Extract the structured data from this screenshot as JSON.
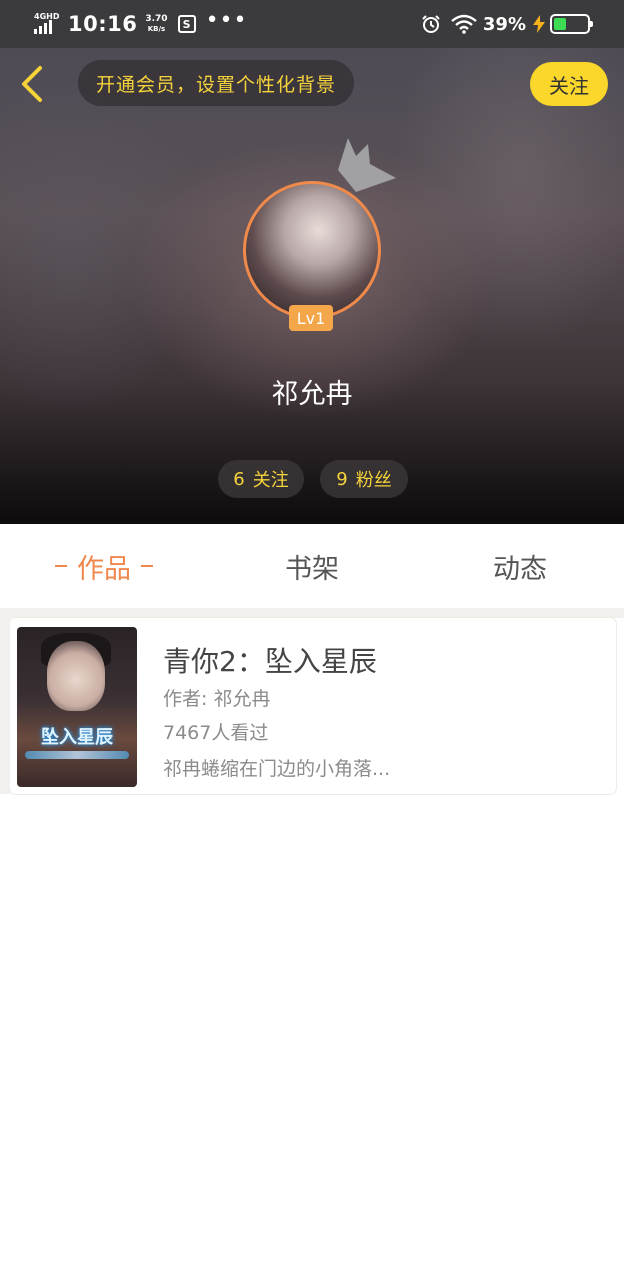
{
  "status_bar": {
    "network": "4GHD",
    "time": "10:16",
    "speed_value": "3.70",
    "speed_unit": "KB/s",
    "app_glyph": "S",
    "more": "•••",
    "battery_percent": "39%",
    "battery_level": 0.39,
    "icons": [
      "alarm-icon",
      "wifi-icon",
      "charging-icon",
      "battery-icon"
    ]
  },
  "header": {
    "vip_banner": "开通会员，设置个性化背景",
    "follow_label": "关注",
    "back_icon": "chevron-left-icon"
  },
  "profile": {
    "level": "Lv1",
    "username": "祁允冉",
    "following_count": "6",
    "following_label": "关注",
    "fans_count": "9",
    "fans_label": "粉丝"
  },
  "tabs": [
    {
      "label": "作品",
      "active": true
    },
    {
      "label": "书架",
      "active": false
    },
    {
      "label": "动态",
      "active": false
    }
  ],
  "works": [
    {
      "title": "青你2：坠入星辰",
      "author": "作者: 祁允冉",
      "views": "7467人看过",
      "intro": "祁冉蜷缩在门边的小角落..."
    }
  ],
  "colors": {
    "accent": "#f0884e",
    "yellow": "#fad72a",
    "banner_text": "#f5d33a"
  }
}
